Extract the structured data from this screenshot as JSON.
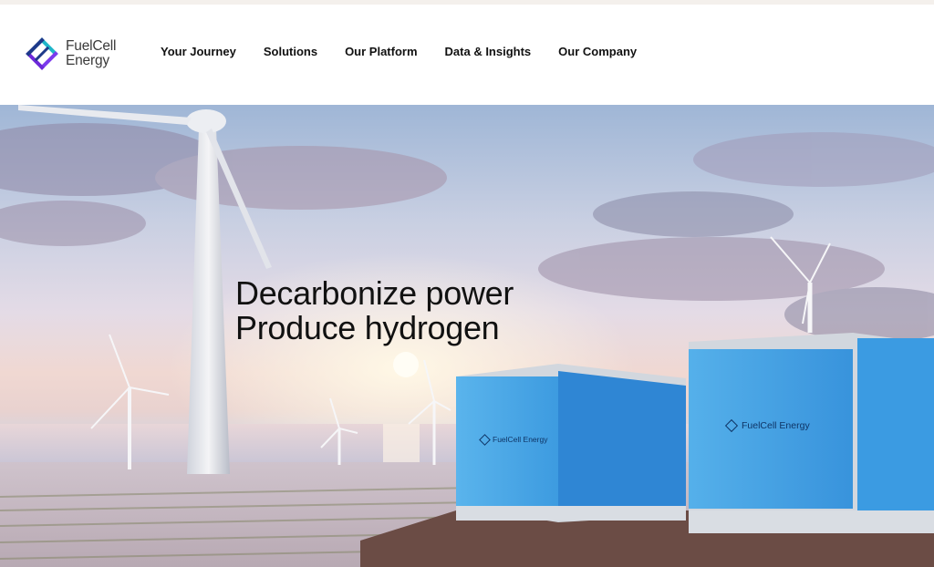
{
  "brand": {
    "name_line1": "FuelCell",
    "name_line2": "Energy",
    "colors": {
      "primary": "#1e3a8a",
      "accent": "#7c3aed",
      "teal": "#1fb6c9"
    }
  },
  "nav": {
    "items": [
      {
        "label": "Your Journey"
      },
      {
        "label": "Solutions"
      },
      {
        "label": "Our Platform"
      },
      {
        "label": "Data & Insights"
      },
      {
        "label": "Our Company"
      }
    ]
  },
  "hero": {
    "headline_line1": "Decarbonize power",
    "headline_line2": "Produce hydrogen",
    "container_left_label": "FuelCell Energy",
    "container_right_label": "FuelCell Energy"
  }
}
